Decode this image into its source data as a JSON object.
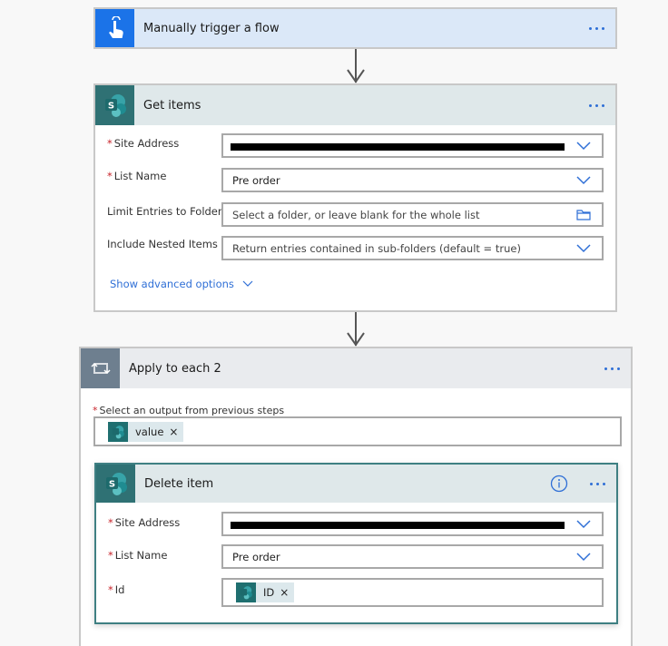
{
  "colors": {
    "accent": "#2f6fd6",
    "trigger_icon_bg": "#1b73e8",
    "trigger_header_bg": "#dbe8f8",
    "sharepoint_icon_bg": "#2f7174",
    "sharepoint_header_bg": "#dfe8ea",
    "loop_icon_bg": "#6e7f8f",
    "loop_header_bg": "#e9ebee",
    "required": "#c8232a"
  },
  "trigger": {
    "title": "Manually trigger a flow",
    "icon": "touch-hand-icon",
    "more": "more-options-icon"
  },
  "get_items": {
    "title": "Get items",
    "icon": "sharepoint-icon",
    "fields": [
      {
        "label": "Site Address",
        "required": "*",
        "value": "[redacted]",
        "control": "chevron-down-icon"
      },
      {
        "label": "List Name",
        "required": "*",
        "value": "Pre order",
        "control": "chevron-down-icon"
      },
      {
        "label": "Limit Entries to Folder",
        "required": "",
        "placeholder": "Select a folder, or leave blank for the whole list",
        "control": "folder-icon"
      },
      {
        "label": "Include Nested Items",
        "required": "",
        "placeholder": "Return entries contained in sub-folders (default = true)",
        "control": "chevron-down-icon"
      }
    ],
    "advanced_link": "Show advanced options"
  },
  "apply_to_each": {
    "title": "Apply to each 2",
    "icon": "loop-icon",
    "output_label": "Select an output from previous steps",
    "required": "*",
    "token": {
      "label": "value",
      "icon": "sharepoint-icon",
      "remove": "×"
    }
  },
  "delete_item": {
    "title": "Delete item",
    "icon": "sharepoint-icon",
    "info_icon": "info-icon",
    "fields": [
      {
        "label": "Site Address",
        "required": "*",
        "value": "[redacted]",
        "control": "chevron-down-icon"
      },
      {
        "label": "List Name",
        "required": "*",
        "value": "Pre order",
        "control": "chevron-down-icon"
      },
      {
        "label": "Id",
        "required": "*",
        "token": {
          "label": "ID",
          "icon": "sharepoint-icon",
          "remove": "×"
        }
      }
    ]
  }
}
